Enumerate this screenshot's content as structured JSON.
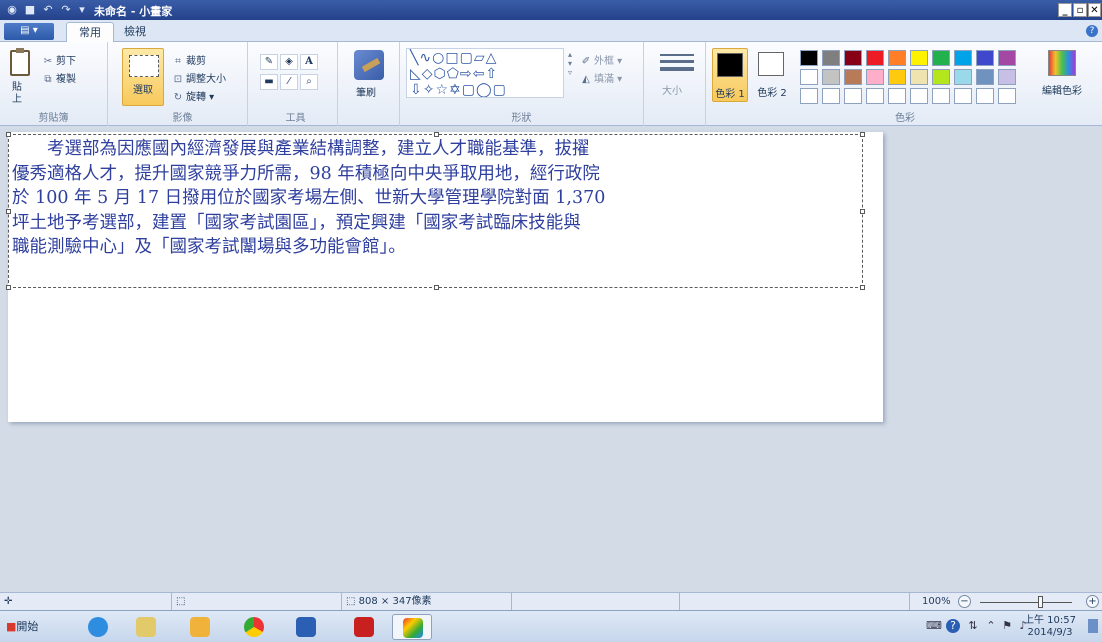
{
  "window": {
    "title": "未命名 - 小畫家",
    "controls": {
      "minimize": "_",
      "maximize": "▫",
      "close": "✕"
    }
  },
  "tabs": [
    {
      "label": "常用",
      "active": true
    },
    {
      "label": "檢視",
      "active": false
    }
  ],
  "ribbon": {
    "clipboard": {
      "paste": "貼上",
      "cut": "剪下",
      "copy": "複製",
      "group_label": "剪貼簿"
    },
    "image": {
      "select": "選取",
      "crop": "裁剪",
      "resize": "調整大小",
      "rotate": "旋轉",
      "group_label": "影像"
    },
    "tools": {
      "group_label": "工具",
      "text_tool": "A"
    },
    "brushes": {
      "label": "筆刷"
    },
    "shapes": {
      "outline": "外框",
      "fill": "填滿",
      "group_label": "形狀"
    },
    "size": {
      "label": "大小"
    },
    "colors": {
      "color1": "色彩 1",
      "color2": "色彩 2",
      "edit": "編輯色彩",
      "group_label": "色彩",
      "row1": [
        "#000000",
        "#7f7f7f",
        "#880015",
        "#ed1c24",
        "#ff7f27",
        "#fff200",
        "#22b14c",
        "#00a2e8",
        "#3f48cc",
        "#a349a4"
      ],
      "row2": [
        "#ffffff",
        "#c3c3c3",
        "#b97a57",
        "#ffaec9",
        "#ffc90e",
        "#efe4b0",
        "#b5e61d",
        "#99d9ea",
        "#7092be",
        "#c8bfe7"
      ]
    }
  },
  "canvas_text": [
    "　　考選部為因應國內經濟發展與產業結構調整，建立人才職能基準，拔擢",
    "優秀適格人才，提升國家競爭力所需，98 年積極向中央爭取用地，經行政院",
    "於 100 年 5 月 17 日撥用位於國家考場左側、世新大學管理學院對面 1,370",
    "坪土地予考選部，建置「國家考試園區」，預定興建「國家考試臨床技能與",
    "職能測驗中心」及「國家考試闈場與多功能會館」。"
  ],
  "status": {
    "selection_size": "808 × 347像素",
    "zoom": "100%"
  },
  "taskbar": {
    "start": "開始",
    "time": "上午 10:57",
    "date": "2014/9/3"
  }
}
